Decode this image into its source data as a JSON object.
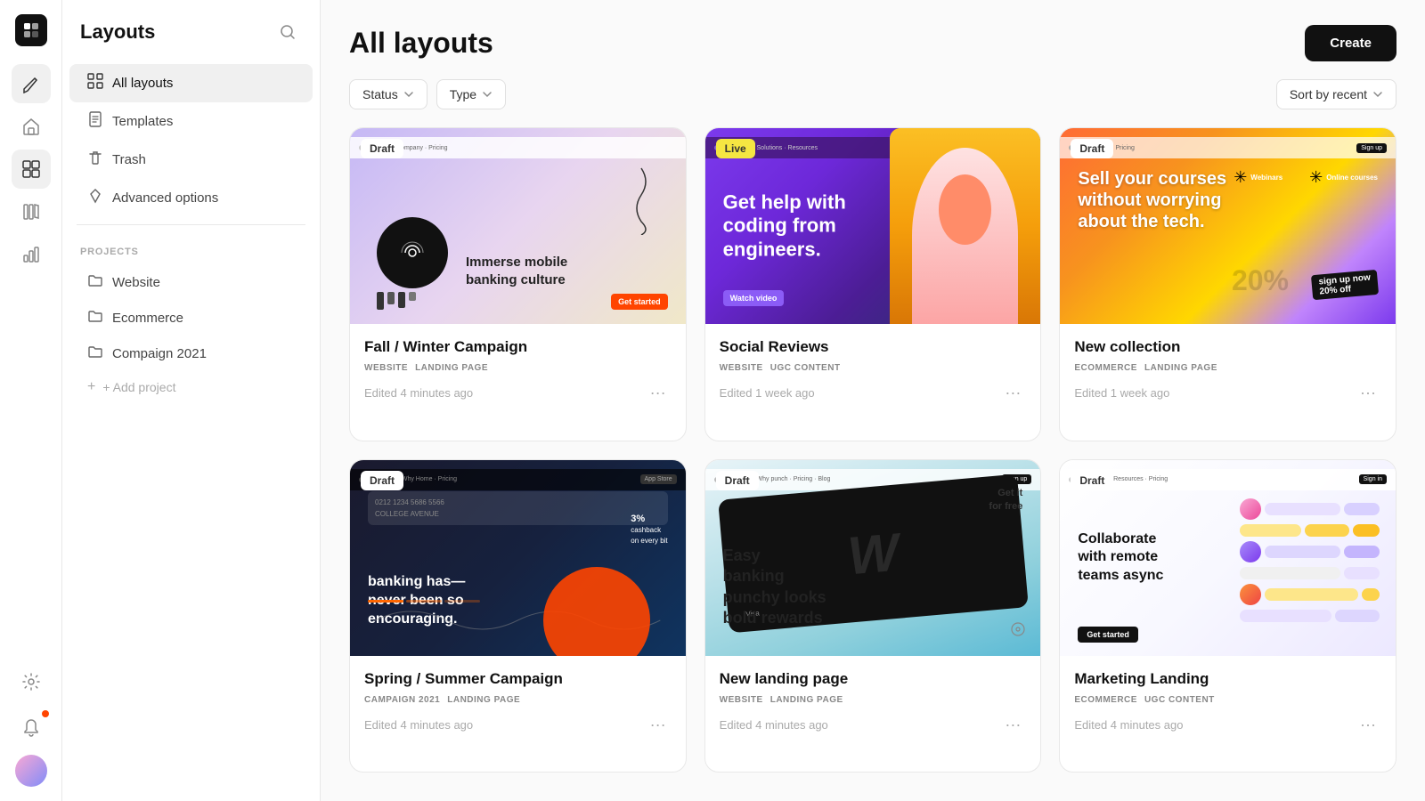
{
  "app": {
    "logo": "◧",
    "title": "Layouts",
    "search_icon": "🔍",
    "create_label": "Create"
  },
  "iconbar": {
    "edit_icon": "✏️",
    "home_icon": "🏠",
    "layouts_icon": "⊞",
    "library_icon": "📚",
    "analytics_icon": "📊",
    "settings_icon": "⚙️",
    "notification_icon": "🔔"
  },
  "sidebar": {
    "nav_items": [
      {
        "id": "all-layouts",
        "label": "All layouts",
        "icon": "grid",
        "active": true
      },
      {
        "id": "templates",
        "label": "Templates",
        "icon": "doc"
      },
      {
        "id": "trash",
        "label": "Trash",
        "icon": "trash"
      },
      {
        "id": "advanced-options",
        "label": "Advanced options",
        "icon": "diamond"
      }
    ],
    "projects_section_title": "PROJECTS",
    "projects": [
      {
        "id": "website",
        "label": "Website"
      },
      {
        "id": "ecommerce",
        "label": "Ecommerce"
      },
      {
        "id": "campaign",
        "label": "Compaign 2021"
      }
    ],
    "add_project_label": "+ Add project"
  },
  "main": {
    "page_title": "All layouts",
    "filters": {
      "status_label": "Status",
      "type_label": "Type",
      "sort_label": "Sort by recent"
    },
    "cards": [
      {
        "id": "card-1",
        "badge": "Draft",
        "badge_type": "draft",
        "title": "Fall / Winter Campaign",
        "category": "WEBSITE",
        "subcategory": "Landing Page",
        "edited": "Edited 4 minutes ago",
        "thumb_type": "thumb-1",
        "thumb_text": "Immerse mobile banking culture"
      },
      {
        "id": "card-2",
        "badge": "Live",
        "badge_type": "live",
        "title": "Social Reviews",
        "category": "WEBSITE",
        "subcategory": "UGC content",
        "edited": "Edited 1 week ago",
        "thumb_type": "thumb-2",
        "thumb_text": "Get help with coding from engineers."
      },
      {
        "id": "card-3",
        "badge": "Draft",
        "badge_type": "draft",
        "title": "New collection",
        "category": "ECOMMERCE",
        "subcategory": "Landing Page",
        "edited": "Edited 1 week ago",
        "thumb_type": "thumb-3",
        "thumb_text": "Sell your courses without worrying about the tech."
      },
      {
        "id": "card-4",
        "badge": "Draft",
        "badge_type": "draft",
        "title": "Spring / Summer Campaign",
        "category": "CAMPAIGN 2021",
        "subcategory": "Landing Page",
        "edited": "Edited 4 minutes ago",
        "thumb_type": "thumb-4",
        "thumb_text": "banking has— never been so encouraging."
      },
      {
        "id": "card-5",
        "badge": "Draft",
        "badge_type": "draft",
        "title": "New landing page",
        "category": "WEBSITE",
        "subcategory": "Landing Page",
        "edited": "Edited 4 minutes ago",
        "thumb_type": "thumb-5",
        "thumb_text": "Easy banking punchy looks bold rewards"
      },
      {
        "id": "card-6",
        "badge": "Draft",
        "badge_type": "draft",
        "title": "Marketing Landing",
        "category": "ECOMMERCE",
        "subcategory": "UGC content",
        "edited": "Edited 4 minutes ago",
        "thumb_type": "thumb-6",
        "thumb_text": "Collaborate with remote teams async"
      }
    ]
  }
}
